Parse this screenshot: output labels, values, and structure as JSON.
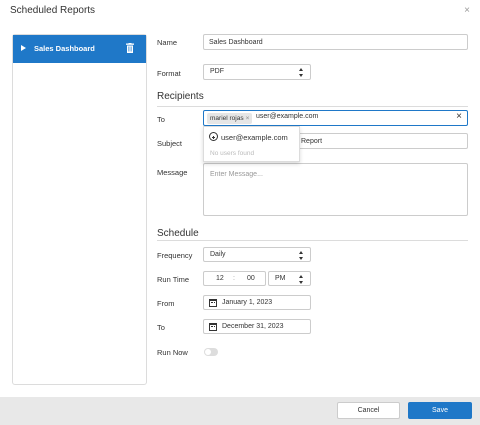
{
  "dialog": {
    "title": "Scheduled Reports",
    "close_glyph": "×"
  },
  "sidebar": {
    "items": [
      {
        "label": "Sales Dashboard",
        "selected": true
      }
    ]
  },
  "form": {
    "name_label": "Name",
    "name_value": "Sales Dashboard",
    "format_label": "Format",
    "format_value": "PDF",
    "recipients_heading": "Recipients",
    "to_label": "To",
    "to_chip": "mariel rojas",
    "to_chip_remove": "×",
    "to_input_value": "user@example.com",
    "to_clear": "×",
    "subject_label": "Subject",
    "subject_visible_value": "Report",
    "message_label": "Message",
    "message_placeholder": "Enter Message..."
  },
  "suggestions": {
    "items": [
      {
        "label": "user@example.com",
        "icon": "add-circle-icon"
      }
    ],
    "empty_text": "No users found"
  },
  "schedule": {
    "heading": "Schedule",
    "frequency_label": "Frequency",
    "frequency_value": "Daily",
    "run_time_label": "Run Time",
    "hour": "12",
    "separator": ":",
    "minute": "00",
    "ampm": "PM",
    "from_label": "From",
    "from_value": "January 1, 2023",
    "to_label": "To",
    "to_value": "December 31, 2023",
    "run_now_label": "Run Now",
    "run_now_on": false
  },
  "footer": {
    "cancel_label": "Cancel",
    "save_label": "Save"
  },
  "colors": {
    "accent": "#1f78c8",
    "footer_bg": "#e8e8e8",
    "border": "#dcdcdc"
  }
}
